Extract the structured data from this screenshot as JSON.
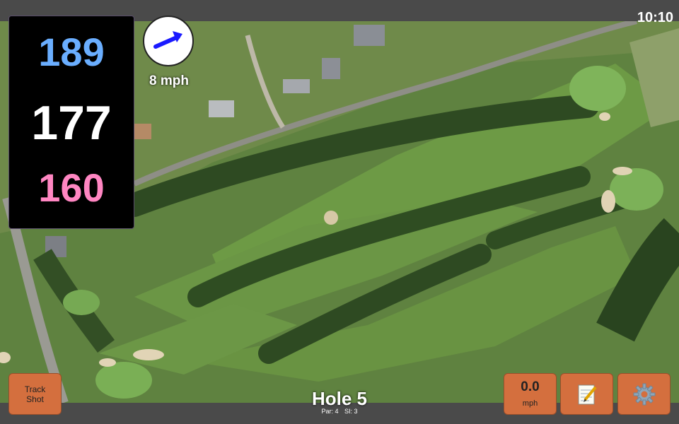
{
  "status": {
    "time": "10:10"
  },
  "yardage": {
    "back": "189",
    "middle": "177",
    "front": "160"
  },
  "wind": {
    "speed_label": "8 mph",
    "button_value": "0.0",
    "button_unit": "mph"
  },
  "buttons": {
    "track_shot_line1": "Track",
    "track_shot_line2": "Shot"
  },
  "hole": {
    "title": "Hole 5",
    "par": "Par: 4",
    "si": "SI: 3"
  },
  "colors": {
    "back": "#6aaeff",
    "middle": "#ffffff",
    "front": "#ff86c2",
    "button": "#d46f3e"
  },
  "icons": {
    "wind": "arrow-icon",
    "scorecard": "notepad-icon",
    "settings": "gear-icon"
  }
}
